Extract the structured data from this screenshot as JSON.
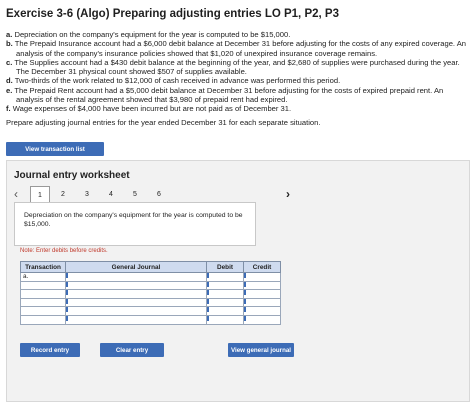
{
  "exercise_title": "Exercise 3-6 (Algo) Preparing adjusting entries LO P1, P2, P3",
  "items": [
    {
      "letter": "a.",
      "text": "Depreciation on the company's equipment for the year is computed to be $15,000."
    },
    {
      "letter": "b.",
      "text": "The Prepaid Insurance account had a $6,000 debit balance at December 31 before adjusting for the costs of any expired coverage. An analysis of the company's insurance policies showed that $1,020 of unexpired insurance coverage remains."
    },
    {
      "letter": "c.",
      "text": "The Supplies account had a $430 debit balance at the beginning of the year, and $2,680 of supplies were purchased during the year. The December 31 physical count showed $507 of supplies available."
    },
    {
      "letter": "d.",
      "text": "Two-thirds of the work related to $12,000 of cash received in advance was performed this period."
    },
    {
      "letter": "e.",
      "text": "The Prepaid Rent account had a $5,000 debit balance at December 31 before adjusting for the costs of expired prepaid rent. An analysis of the rental agreement showed that $3,980 of prepaid rent had expired."
    },
    {
      "letter": "f.",
      "text": "Wage expenses of $4,000 have been incurred but are not paid as of December 31."
    }
  ],
  "prompt": "Prepare adjusting journal entries for the year ended December 31 for each separate situation.",
  "view_transaction_list": "View transaction list",
  "worksheet": {
    "title": "Journal entry worksheet",
    "tabs": [
      "1",
      "2",
      "3",
      "4",
      "5",
      "6"
    ],
    "active_tab": "1",
    "description": "Depreciation on the company's equipment for the year is computed to be $15,000.",
    "note": "Note: Enter debits before credits.",
    "columns": [
      "Transaction",
      "General Journal",
      "Debit",
      "Credit"
    ],
    "rows": [
      {
        "transaction": "a.",
        "journal": "",
        "debit": "",
        "credit": ""
      },
      {
        "transaction": "",
        "journal": "",
        "debit": "",
        "credit": ""
      },
      {
        "transaction": "",
        "journal": "",
        "debit": "",
        "credit": ""
      },
      {
        "transaction": "",
        "journal": "",
        "debit": "",
        "credit": ""
      },
      {
        "transaction": "",
        "journal": "",
        "debit": "",
        "credit": ""
      },
      {
        "transaction": "",
        "journal": "",
        "debit": "",
        "credit": ""
      }
    ],
    "buttons": {
      "record": "Record entry",
      "clear": "Clear entry",
      "general_journal": "View general journal"
    }
  },
  "colors": {
    "accent": "#3d6cb6",
    "header_bg": "#cfdbef",
    "note": "#c0392b"
  },
  "icons": {
    "prev": "chevron-left-icon",
    "next": "chevron-right-icon"
  }
}
